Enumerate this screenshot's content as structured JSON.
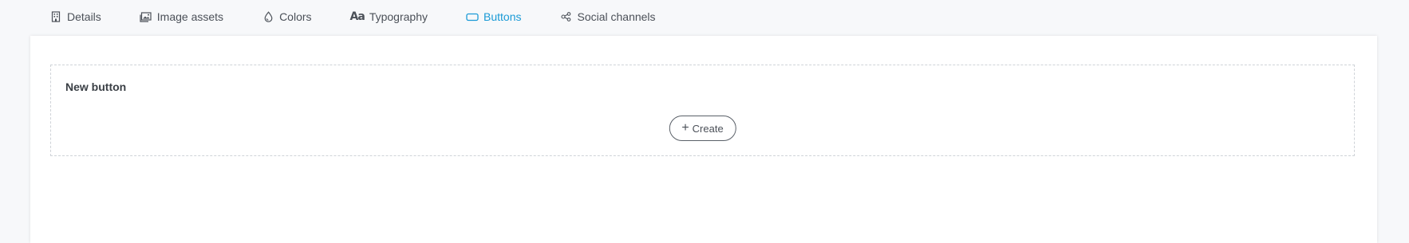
{
  "tabs": [
    {
      "label": "Details",
      "icon": "building-icon",
      "active": false
    },
    {
      "label": "Image assets",
      "icon": "image-icon",
      "active": false
    },
    {
      "label": "Colors",
      "icon": "drop-icon",
      "active": false
    },
    {
      "label": "Typography",
      "icon": "typography-icon",
      "icon_text": "Aa",
      "active": false
    },
    {
      "label": "Buttons",
      "icon": "button-icon",
      "active": true
    },
    {
      "label": "Social channels",
      "icon": "share-icon",
      "active": false
    }
  ],
  "section": {
    "title": "New button",
    "create_label": "Create",
    "create_icon": "plus-icon"
  },
  "colors": {
    "accent": "#1a9ad6",
    "text": "#3a3f45",
    "background": "#f7f8fa",
    "panel": "#ffffff"
  }
}
